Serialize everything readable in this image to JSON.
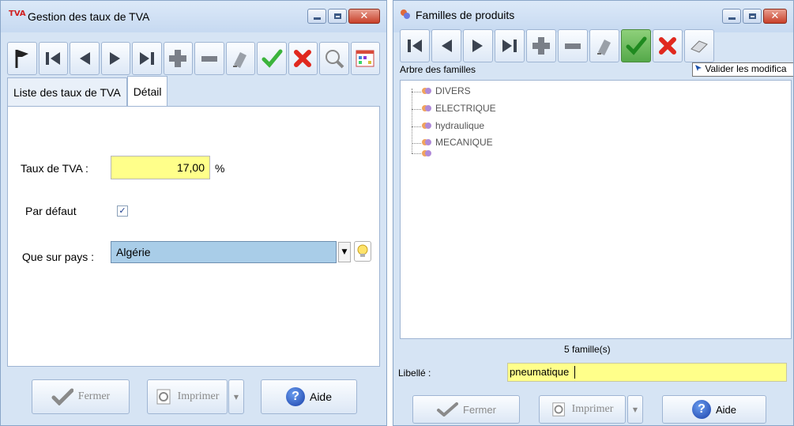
{
  "window_tva": {
    "title": "Gestion des taux de TVA",
    "title_icon_text": "TVA",
    "tabs": [
      {
        "label": "Liste des taux de TVA"
      },
      {
        "label": "Détail"
      }
    ],
    "fields": {
      "taux_label": "Taux de TVA :",
      "taux_value": "17,00",
      "taux_unit": "%",
      "defaut_label": "Par défaut",
      "defaut_checked": true,
      "pays_label": "Que sur pays :",
      "pays_value": "Algérie"
    },
    "buttons": {
      "fermer": "Fermer",
      "imprimer": "Imprimer",
      "aide": "Aide"
    }
  },
  "window_familles": {
    "title": "Familles de produits",
    "tree_title": "Arbre des familles",
    "tooltip": "Valider les modifica",
    "tree_items": [
      {
        "label": "DIVERS"
      },
      {
        "label": "ELECTRIQUE"
      },
      {
        "label": "hydraulique"
      },
      {
        "label": "MECANIQUE"
      },
      {
        "label": ""
      }
    ],
    "count": "5 famille(s)",
    "libelle_label": "Libellé :",
    "libelle_value": "pneumatique",
    "buttons": {
      "fermer": "Fermer",
      "imprimer": "Imprimer",
      "aide": "Aide"
    }
  },
  "colors": {
    "field_yellow": "#ffff8a",
    "combo_blue": "#a9cde8",
    "window_bg": "#d6e4f4",
    "close_red": "#c8402a"
  }
}
